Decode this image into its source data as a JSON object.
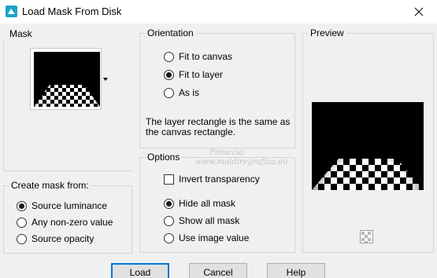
{
  "window": {
    "title": "Load Mask From Disk"
  },
  "mask": {
    "group_label": "Mask"
  },
  "orientation": {
    "group_label": "Orientation",
    "options": [
      "Fit to canvas",
      "Fit to layer",
      "As is"
    ],
    "selected": "Fit to layer",
    "info_line1": "The layer rectangle is the same as",
    "info_line2": "the canvas rectangle."
  },
  "preview": {
    "group_label": "Preview"
  },
  "create_mask": {
    "group_label": "Create mask from:",
    "options": [
      "Source luminance",
      "Any non-zero value",
      "Source opacity"
    ],
    "selected": "Source luminance"
  },
  "options": {
    "group_label": "Options",
    "invert_label": "Invert transparency",
    "invert_checked": false,
    "mask_options": [
      "Hide all mask",
      "Show all mask",
      "Use image value"
    ],
    "selected": "Hide all mask"
  },
  "buttons": {
    "load": "Load",
    "cancel": "Cancel",
    "help": "Help"
  },
  "watermark": {
    "line1": "Pinuccia",
    "line2": "www.maldiregrafica.eu"
  }
}
